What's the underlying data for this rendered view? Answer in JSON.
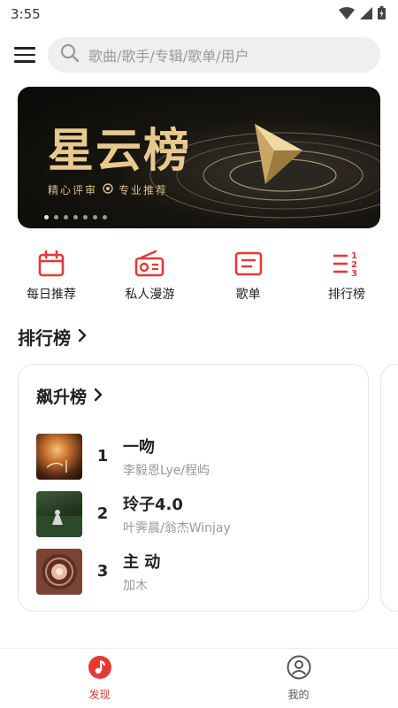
{
  "status": {
    "time": "3:55"
  },
  "search": {
    "placeholder": "歌曲/歌手/专辑/歌单/用户"
  },
  "banner": {
    "title": "星云榜",
    "subtitle_left": "精心评审",
    "subtitle_right": "专业推荐",
    "dot_count": 7,
    "active_dot": 0
  },
  "quick_nav": [
    {
      "label": "每日推荐",
      "icon": "calendar-icon"
    },
    {
      "label": "私人漫游",
      "icon": "radio-icon"
    },
    {
      "label": "歌单",
      "icon": "playlist-icon"
    },
    {
      "label": "排行榜",
      "icon": "ranking-icon"
    }
  ],
  "ranking": {
    "section_title": "排行榜",
    "card_title": "飙升榜",
    "songs": [
      {
        "rank": "1",
        "title": "一吻",
        "artist": "李毅恩Lye/程屿"
      },
      {
        "rank": "2",
        "title": "玲子4.0",
        "artist": "叶霁晨/翁杰Winjay"
      },
      {
        "rank": "3",
        "title": "主 动",
        "artist": "加木"
      }
    ]
  },
  "tabbar": {
    "discover": "发现",
    "mine": "我的",
    "active_color": "#e53935",
    "inactive_color": "#555555"
  },
  "colors": {
    "accent": "#e53935"
  }
}
